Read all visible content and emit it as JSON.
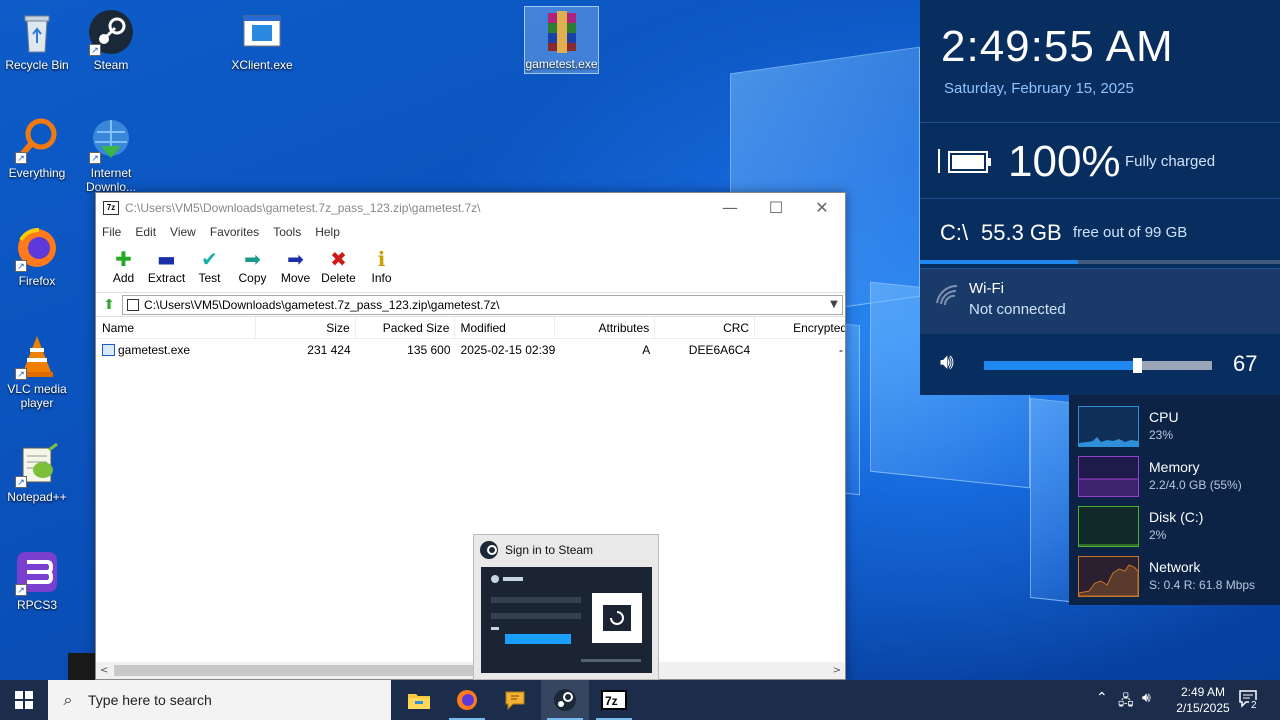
{
  "desktop": {
    "icons": [
      {
        "label": "Recycle Bin",
        "icon": "recycle-bin-icon"
      },
      {
        "label": "Steam",
        "icon": "steam-icon"
      },
      {
        "label": "XClient.exe",
        "icon": "exe-window-icon"
      },
      {
        "label": "gametest.exe",
        "icon": "winrar-archive-icon"
      },
      {
        "label": "Everything",
        "icon": "everything-search-icon"
      },
      {
        "label": "Internet Downlo...",
        "icon": "internet-download-manager-icon"
      },
      {
        "label": "Firefox",
        "icon": "firefox-icon"
      },
      {
        "label": "VLC media player",
        "icon": "vlc-icon"
      },
      {
        "label": "Notepad++",
        "icon": "notepad-plus-plus-icon"
      },
      {
        "label": "RPCS3",
        "icon": "rpcs3-icon"
      }
    ]
  },
  "window": {
    "title": "C:\\Users\\VM5\\Downloads\\gametest.7z_pass_123.zip\\gametest.7z\\",
    "app_icon_text": "7z",
    "minimize": "—",
    "maximize": "☐",
    "close": "✕",
    "menu": [
      "File",
      "Edit",
      "View",
      "Favorites",
      "Tools",
      "Help"
    ],
    "toolbar": [
      {
        "label": "Add",
        "icon": "plus-icon",
        "glyph": "✚",
        "color": "#22a822"
      },
      {
        "label": "Extract",
        "icon": "minus-icon",
        "glyph": "▬",
        "color": "#1a2fa8"
      },
      {
        "label": "Test",
        "icon": "check-icon",
        "glyph": "✔",
        "color": "#19b0a8"
      },
      {
        "label": "Copy",
        "icon": "copy-arrow-icon",
        "glyph": "➡",
        "color": "#1a9a8a"
      },
      {
        "label": "Move",
        "icon": "move-arrow-icon",
        "glyph": "➡",
        "color": "#1a2fa8"
      },
      {
        "label": "Delete",
        "icon": "delete-x-icon",
        "glyph": "✖",
        "color": "#d01818"
      },
      {
        "label": "Info",
        "icon": "info-icon",
        "glyph": "ℹ",
        "color": "#c8a000"
      }
    ],
    "address": "C:\\Users\\VM5\\Downloads\\gametest.7z_pass_123.zip\\gametest.7z\\",
    "columns": [
      "Name",
      "Size",
      "Packed Size",
      "Modified",
      "Attributes",
      "CRC",
      "Encrypted"
    ],
    "rows": [
      {
        "name": "gametest.exe",
        "size": "231 424",
        "packed": "135 600",
        "modified": "2025-02-15 02:39",
        "attributes": "A",
        "crc": "DEE6A6C4",
        "encrypted": "-"
      }
    ]
  },
  "steam_popup": {
    "title": "Sign in to Steam"
  },
  "notifications": {
    "time": "2:49:55 AM",
    "date": "Saturday, February 15, 2025",
    "battery": {
      "percent": "100%",
      "status": "Fully charged"
    },
    "disk": {
      "label": "C:\\",
      "free": "55.3 GB",
      "detail": "free out of 99 GB",
      "used_fraction": 0.44
    },
    "wifi": {
      "name": "Wi-Fi",
      "status": "Not connected"
    },
    "volume": {
      "value": "67",
      "level": 67
    }
  },
  "performance": [
    {
      "name": "CPU",
      "value": "23%",
      "color": "#2e8fd8"
    },
    {
      "name": "Memory",
      "value": "2.2/4.0 GB (55%)",
      "color": "#9b3fd0"
    },
    {
      "name": "Disk (C:)",
      "value": "2%",
      "color": "#4caf2e"
    },
    {
      "name": "Network",
      "value": "S: 0.4 R: 61.8 Mbps",
      "color": "#c8742a"
    }
  ],
  "taskbar": {
    "search_placeholder": "Type here to search",
    "time": "2:49 AM",
    "date": "2/15/2025",
    "notification_count": "2",
    "apps": [
      {
        "name": "file-explorer-icon"
      },
      {
        "name": "firefox-icon"
      },
      {
        "name": "chat-bubble-icon"
      },
      {
        "name": "steam-icon"
      },
      {
        "name": "7zip-icon"
      }
    ]
  }
}
